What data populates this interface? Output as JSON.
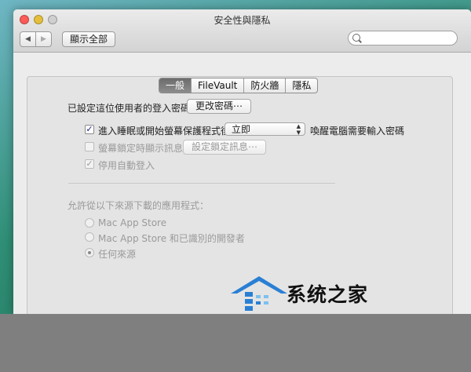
{
  "window": {
    "title": "安全性與隱私"
  },
  "toolbar": {
    "back_icon": "back-icon",
    "forward_icon": "forward-icon",
    "show_all_label": "顯示全部",
    "search_placeholder": ""
  },
  "tabs": [
    {
      "label": "一般",
      "selected": true
    },
    {
      "label": "FileVault",
      "selected": false
    },
    {
      "label": "防火牆",
      "selected": false
    },
    {
      "label": "隱私",
      "selected": false
    }
  ],
  "general": {
    "password_set_label": "已設定這位使用者的登入密碼",
    "change_password_button": "更改密碼⋯",
    "require_password_label": "進入睡眠或開始螢幕保護程式後",
    "require_password_checked": true,
    "require_password_select": "立即",
    "require_password_suffix": "喚醒電腦需要輸入密碼",
    "show_message_label": "螢幕鎖定時顯示訊息",
    "show_message_checked": false,
    "set_lock_message_button": "設定鎖定訊息⋯",
    "disable_autologin_label": "停用自動登入",
    "disable_autologin_checked": true,
    "allow_apps_label": "允許從以下來源下載的應用程式：",
    "sources": [
      {
        "label": "Mac App Store",
        "selected": false
      },
      {
        "label": "Mac App Store 和已識別的開發者",
        "selected": false
      },
      {
        "label": "任何來源",
        "selected": true
      }
    ]
  },
  "watermark": {
    "text": "系统之家"
  },
  "colors": {
    "tab_selected": "#7a7a7a",
    "close_light": "#fc5b57",
    "minimize_light": "#e5bf3c",
    "watermark_blue": "#2a7fd4"
  }
}
